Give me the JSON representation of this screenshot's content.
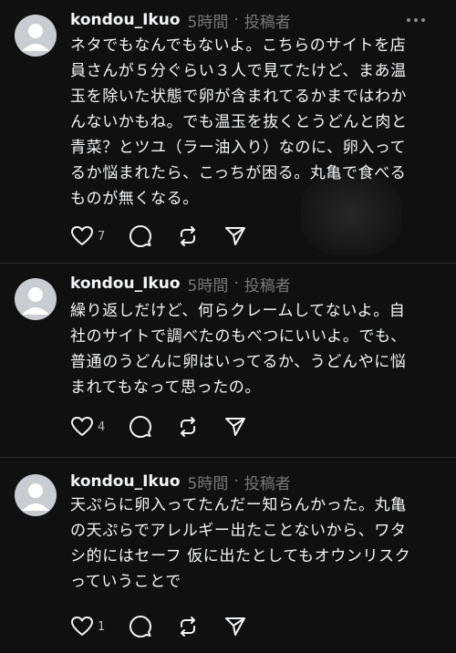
{
  "posts": [
    {
      "username": "kondou_Ikuo",
      "time": "5時間",
      "tag": "投稿者",
      "text_lines": [
        "ネタでもなんでもないよ。こちらのサイトを店",
        "員さんが５分ぐらい３人で見てたけど、まあ温",
        "玉を除いた状態で卵が含まれてるかまではわか",
        "んないかもね。でも温玉を抜くとうどんと肉と",
        "青菜？とツユ（ラー油入り）なのに、卵入って",
        "るか悩まれたら、こっちが困る。丸亀で食べる",
        "ものが無くなる。"
      ],
      "likes": "7"
    },
    {
      "username": "kondou_Ikuo",
      "time": "5時間",
      "tag": "投稿者",
      "text_lines": [
        "繰り返しだけど、何らクレームしてないよ。自",
        "社のサイトで調べたのもべつにいいよ。でも、",
        "普通のうどんに卵はいってるか、うどんやに悩",
        "まれてもなって思ったの。"
      ],
      "likes": "4"
    },
    {
      "username": "kondou_Ikuo",
      "time": "5時間",
      "tag": "投稿者",
      "text_lines": [
        "天ぷらに卵入ってたんだー知らんかった。丸亀",
        "の天ぷらでアレルギー出たことないから、ワタ",
        "シ的にはセーフ 仮に出たとしてもオウンリスク",
        "っていうことで"
      ],
      "likes": "1"
    }
  ],
  "separator": "·",
  "icons": {
    "avatar": "default-avatar-icon",
    "more": "more-horizontal-icon",
    "like": "heart-icon",
    "reply": "comment-bubble-icon",
    "repost": "repost-icon",
    "share": "share-send-icon"
  },
  "colors": {
    "background": "#101010",
    "text": "#f3f5f7",
    "muted": "#777777",
    "divider": "#2d2d2d"
  }
}
